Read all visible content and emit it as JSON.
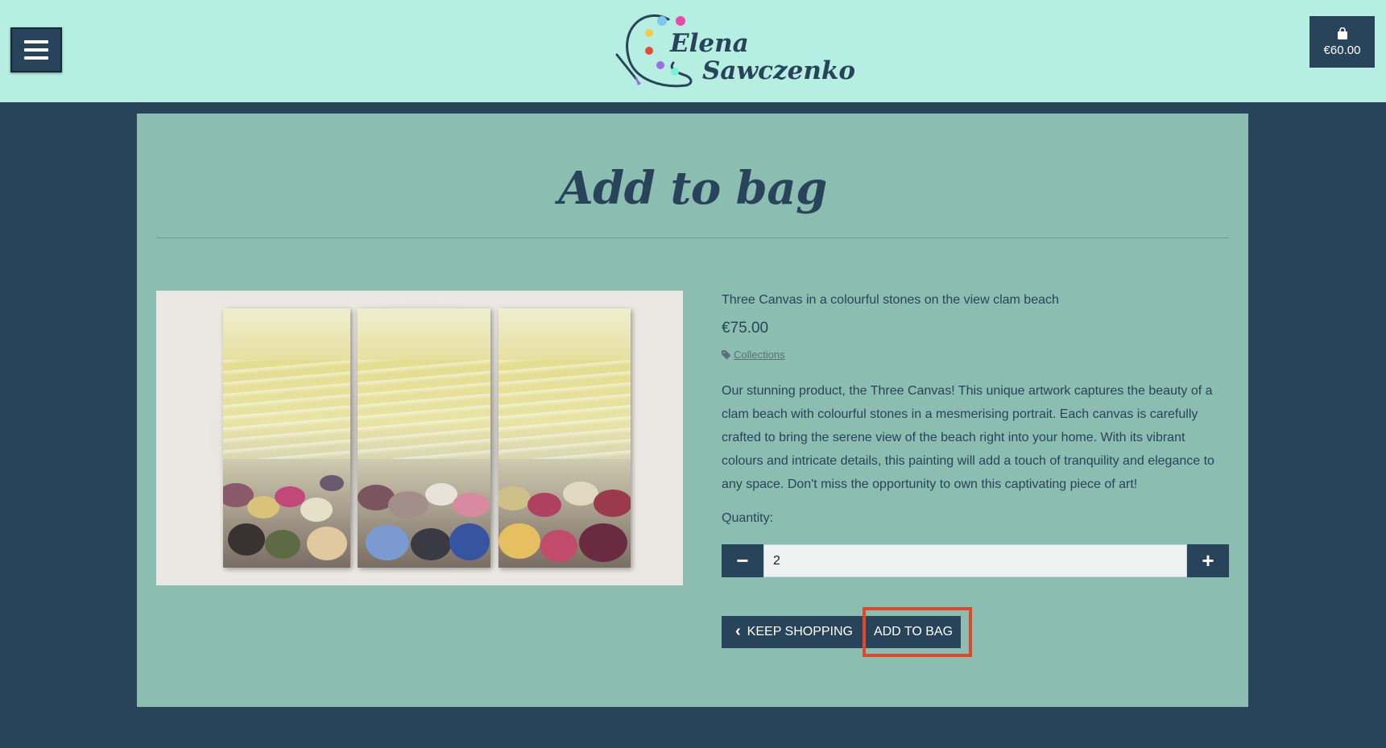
{
  "header": {
    "logo": {
      "first_name": "Elena",
      "last_name": "Sawczenko"
    },
    "bag": {
      "total": "€60.00",
      "icon": "shopping-bag-icon"
    },
    "menu_icon": "hamburger-menu-icon"
  },
  "main": {
    "title": "Add to bag",
    "product": {
      "name": "Three Canvas in a colourful stones on the view clam beach",
      "price": "€75.00",
      "category": "Collections",
      "description": "Our stunning product, the Three Canvas! This unique artwork captures the beauty of a clam beach with colourful stones in a mesmerising portrait. Each canvas is carefully crafted to bring the serene view of the beach right into your home. With its vibrant colours and intricate details, this painting will add a touch of tranquility and elegance to any space. Don't miss the opportunity to own this captivating piece of art!"
    },
    "quantity": {
      "label": "Quantity:",
      "value": "2",
      "decrement": "−",
      "increment": "+"
    },
    "buttons": {
      "keep_shopping": "KEEP SHOPPING",
      "add_to_bag": "ADD TO BAG"
    }
  },
  "colors": {
    "header_bg": "#b6efe2",
    "page_bg": "#27445a",
    "card_bg": "#8bbdb0",
    "highlight": "#e0482b"
  }
}
